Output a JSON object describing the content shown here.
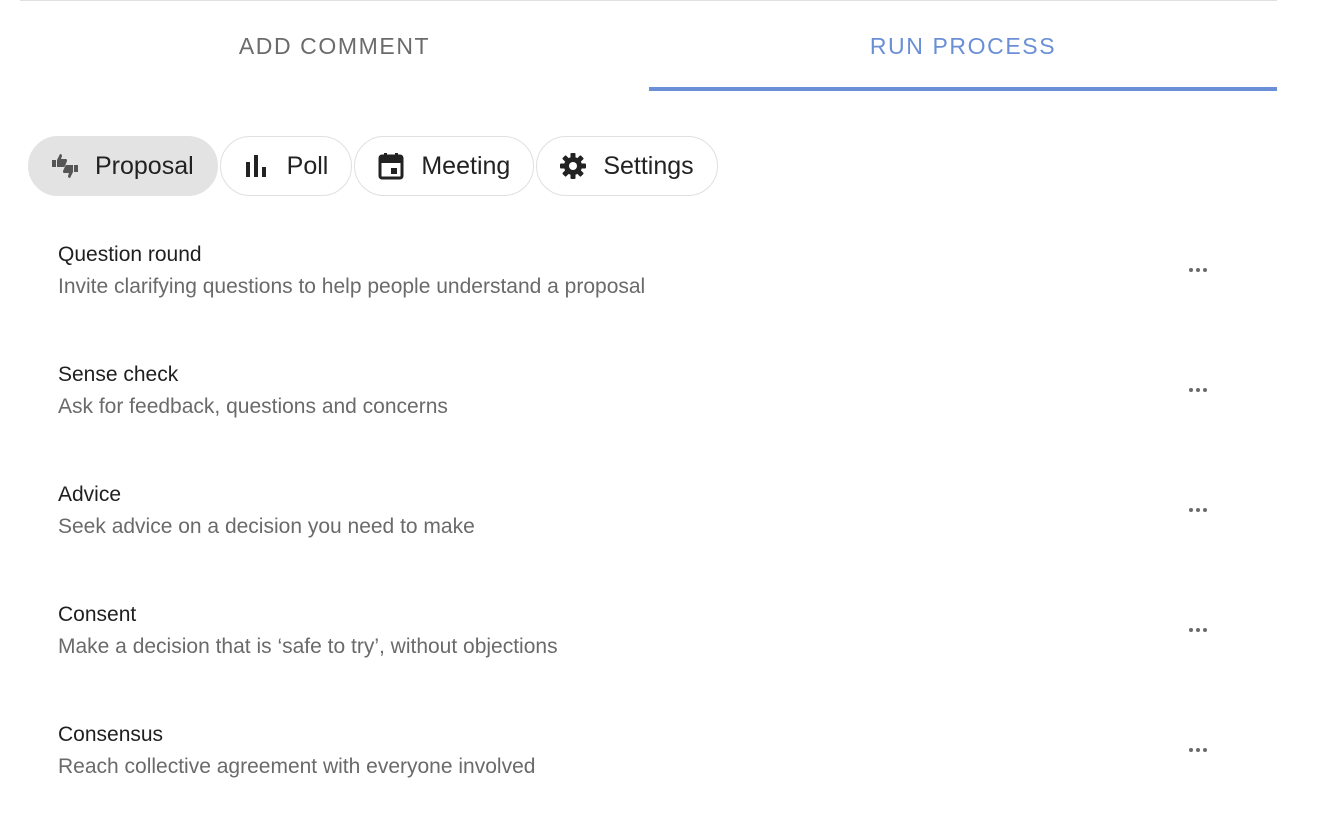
{
  "tabs": {
    "add_comment": "ADD COMMENT",
    "run_process": "RUN PROCESS",
    "active": "run_process",
    "active_color": "#6b8fd6"
  },
  "chips": {
    "proposal": {
      "label": "Proposal",
      "icon": "thumbs-up-down-icon",
      "selected": true
    },
    "poll": {
      "label": "Poll",
      "icon": "bar-chart-icon",
      "selected": false
    },
    "meeting": {
      "label": "Meeting",
      "icon": "calendar-icon",
      "selected": false
    },
    "settings": {
      "label": "Settings",
      "icon": "gear-icon",
      "selected": false
    }
  },
  "processes": [
    {
      "title": "Question round",
      "description": "Invite clarifying questions to help people understand a proposal"
    },
    {
      "title": "Sense check",
      "description": "Ask for feedback, questions and concerns"
    },
    {
      "title": "Advice",
      "description": "Seek advice on a decision you need to make"
    },
    {
      "title": "Consent",
      "description": "Make a decision that is ‘safe to try’, without objections"
    },
    {
      "title": "Consensus",
      "description": "Reach collective agreement with everyone involved"
    }
  ]
}
